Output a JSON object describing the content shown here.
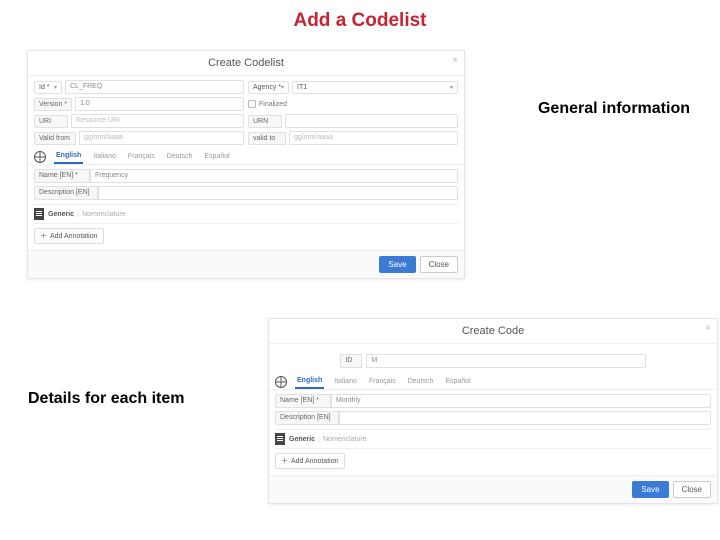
{
  "page_title": "Add a Codelist",
  "callouts": {
    "general_info": "General information",
    "details": "Details for each item"
  },
  "dialog1": {
    "title": "Create Codelist",
    "id_label": "Id *",
    "id_value": "CL_FREQ",
    "agency_label": "Agency *",
    "agency_value": "IT1",
    "version_label": "Version *",
    "version_value": "1.0",
    "finalized_label": "Finalized",
    "uri_label": "URI",
    "uri_placeholder": "Resource URI",
    "urn_label": "URN",
    "valid_from_label": "Valid from",
    "valid_to_label": "valid to",
    "date_placeholder": "gg/mm/aaaa",
    "langs": [
      "English",
      "Italiano",
      "Français",
      "Deutsch",
      "Español"
    ],
    "name_label": "Name [EN] *",
    "name_value": "Frequency",
    "desc_label": "Description [EN]",
    "generic_label": "Generic",
    "generic_value": "Nomenclature",
    "add_annotation": "Add Annotation",
    "save": "Save",
    "close": "Close"
  },
  "dialog2": {
    "title": "Create Code",
    "id_label": "ID",
    "id_value": "M",
    "langs": [
      "English",
      "Italiano",
      "Français",
      "Deutsch",
      "Español"
    ],
    "name_label": "Name [EN] *",
    "name_value": "Monthly",
    "desc_label": "Description [EN]",
    "generic_label": "Generic",
    "generic_value": "Nomenclature",
    "add_annotation": "Add Annotation",
    "save": "Save",
    "close": "Close"
  }
}
